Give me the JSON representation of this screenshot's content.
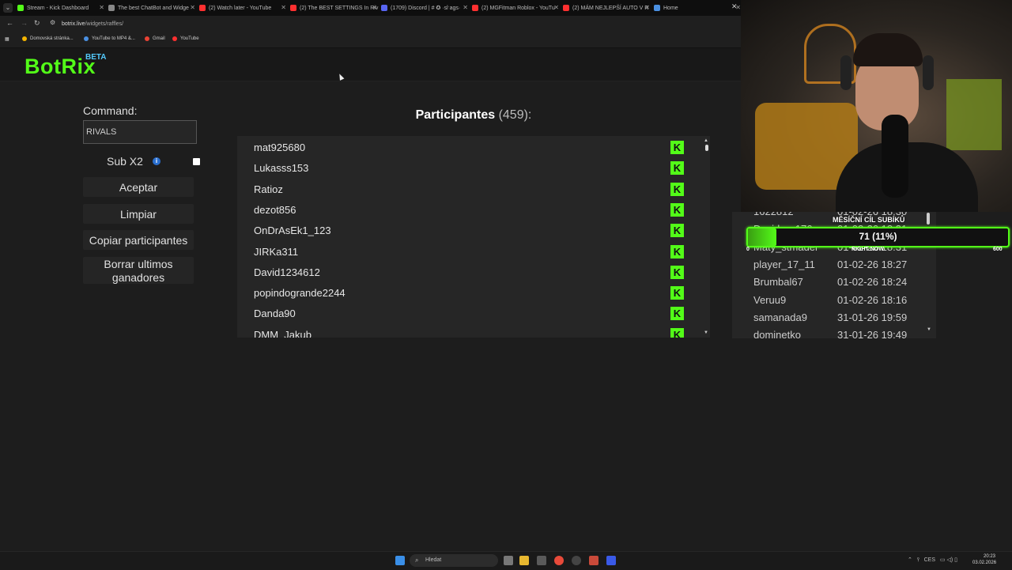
{
  "browser": {
    "tabs": [
      {
        "title": "Stream - Kick Dashboard",
        "color": "#53fc18"
      },
      {
        "title": "The best ChatBot and Widge",
        "color": "#888888"
      },
      {
        "title": "(2) Watch later - YouTube",
        "color": "#ff3030"
      },
      {
        "title": "(2) The BEST SETTINGS In Riv",
        "color": "#ff3030"
      },
      {
        "title": "(1709) Discord | # ✪ ·slˑags·",
        "color": "#5865f2"
      },
      {
        "title": "(2) MGFitman Roblox - YouTu",
        "color": "#ff3030"
      },
      {
        "title": "(2) MÁM NEJLEPŠÍ AUTO V R",
        "color": "#ff3030"
      },
      {
        "title": "Home",
        "color": "#4a90e2"
      }
    ],
    "url_host": "botrix.live",
    "url_path": "/widgets/raffles/",
    "bookmarks": [
      {
        "label": "Domovská stránka...",
        "color": "#f4b400"
      },
      {
        "label": "YouTube to MP4 &...",
        "color": "#4a90e2"
      },
      {
        "label": "Gmail",
        "color": "#ea4335"
      },
      {
        "label": "YouTube",
        "color": "#ff3030"
      }
    ]
  },
  "header": {
    "logo": "BotRix",
    "badge": "BETA"
  },
  "form": {
    "command_label": "Command:",
    "command_value": "RIVALS",
    "sub_label": "Sub X2",
    "sub_checked": false,
    "buttons": {
      "accept": "Aceptar",
      "clear": "Limpiar",
      "copy": "Copiar participantes",
      "delete": "Borrar ultimos ganadores"
    }
  },
  "participants": {
    "title": "Participantes",
    "count": "(459):",
    "list": [
      "mat925680",
      "Lukasss153",
      "Ratioz",
      "dezot856",
      "OnDrAsEk1_123",
      "JIRKa311",
      "David1234612",
      "popindogrande2244",
      "Danda90",
      "DMM_Jakub"
    ],
    "platform_badge": "K"
  },
  "winners": {
    "rows": [
      {
        "name": "1622812",
        "date": "01-02-26 18:30"
      },
      {
        "name": "Davidsxy176",
        "date": "01-02-26 18:31"
      },
      {
        "name": "Maty_stmadel",
        "date": "01-02-26 18:31"
      },
      {
        "name": "player_17_11",
        "date": "01-02-26 18:27"
      },
      {
        "name": "Brumbal67",
        "date": "01-02-26 18:24"
      },
      {
        "name": "Veruu9",
        "date": "01-02-26 18:16"
      },
      {
        "name": "samanada9",
        "date": "31-01-26 19:59"
      },
      {
        "name": "dominetko",
        "date": "31-01-26 19:49"
      }
    ]
  },
  "goal": {
    "title": "MĚSÍČNÍ CÍL SUBÍKŮ",
    "value_text": "71 (11%)",
    "progress": 0.11,
    "min": "0",
    "max": "600",
    "sub": "RIGHT NOW"
  },
  "taskbar": {
    "search_placeholder": "Hledat",
    "tray_lang": "CES",
    "time": "20:23",
    "date": "03.02.2026"
  }
}
